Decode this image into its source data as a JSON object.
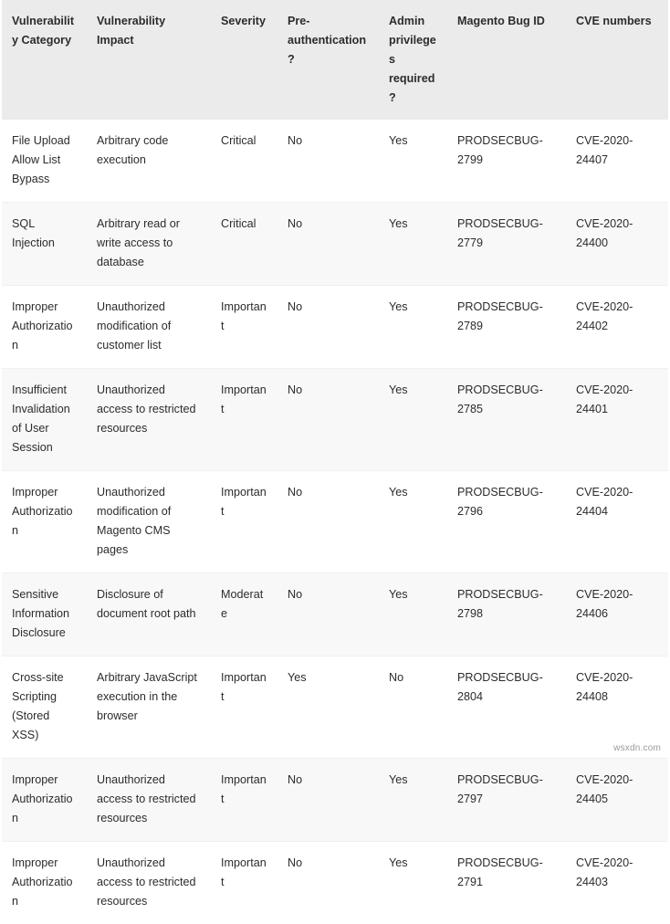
{
  "table": {
    "name": "magento-security-vulnerabilities-table",
    "columns": [
      {
        "key": "category",
        "label": "Vulnerability Category"
      },
      {
        "key": "impact",
        "label": "Vulnerability Impact"
      },
      {
        "key": "severity",
        "label": "Severity"
      },
      {
        "key": "preauth",
        "label": "Pre-authentication?"
      },
      {
        "key": "admin",
        "label": "Admin privileges required?"
      },
      {
        "key": "bugid",
        "label": "Magento Bug ID"
      },
      {
        "key": "cve",
        "label": "CVE numbers"
      }
    ],
    "rows": [
      {
        "category": "File Upload Allow List Bypass",
        "impact": "Arbitrary code execution",
        "severity": "Critical",
        "preauth": "No",
        "admin": "Yes",
        "bugid": "PRODSECBUG-2799",
        "cve": "CVE-2020-24407"
      },
      {
        "category": "SQL Injection",
        "impact": "Arbitrary read or write access to database",
        "severity": "Critical",
        "preauth": "No",
        "admin": "Yes",
        "bugid": "PRODSECBUG-2779",
        "cve": "CVE-2020-24400"
      },
      {
        "category": "Improper Authorization",
        "impact": "Unauthorized modification of customer list",
        "severity": "Important",
        "preauth": "No",
        "admin": "Yes",
        "bugid": "PRODSECBUG-2789",
        "cve": "CVE-2020-24402"
      },
      {
        "category": "Insufficient Invalidation of User Session",
        "impact": "Unauthorized access to restricted resources",
        "severity": "Important",
        "preauth": "No",
        "admin": "Yes",
        "bugid": "PRODSECBUG-2785",
        "cve": "CVE-2020-24401"
      },
      {
        "category": "Improper Authorization",
        "impact": "Unauthorized modification of Magento CMS pages",
        "severity": "Important",
        "preauth": "No",
        "admin": "Yes",
        "bugid": "PRODSECBUG-2796",
        "cve": "CVE-2020-24404"
      },
      {
        "category": "Sensitive Information Disclosure",
        "impact": "Disclosure of document root path",
        "severity": "Moderate",
        "preauth": "No",
        "admin": "Yes",
        "bugid": "PRODSECBUG-2798",
        "cve": "CVE-2020-24406"
      },
      {
        "category": "Cross-site Scripting (Stored XSS)",
        "impact": "Arbitrary JavaScript execution in the browser",
        "severity": "Important",
        "preauth": "Yes",
        "admin": "No",
        "bugid": "PRODSECBUG-2804",
        "cve": "CVE-2020-24408"
      },
      {
        "category": "Improper Authorization",
        "impact": "Unauthorized access to restricted resources",
        "severity": "Important",
        "preauth": "No",
        "admin": "Yes",
        "bugid": "PRODSECBUG-2797",
        "cve": "CVE-2020-24405"
      },
      {
        "category": "Improper Authorization",
        "impact": "Unauthorized access to restricted resources",
        "severity": "Important",
        "preauth": "No",
        "admin": "Yes",
        "bugid": "PRODSECBUG-2791",
        "cve": "CVE-2020-24403"
      }
    ]
  },
  "watermark": {
    "text": "wsxdn.com"
  },
  "colors": {
    "header_background": "#ebebeb",
    "row_stripe": "#f8f8f8",
    "row_plain": "#ffffff",
    "text": "#2c2c2c",
    "watermark_text": "#9a9a9a"
  }
}
